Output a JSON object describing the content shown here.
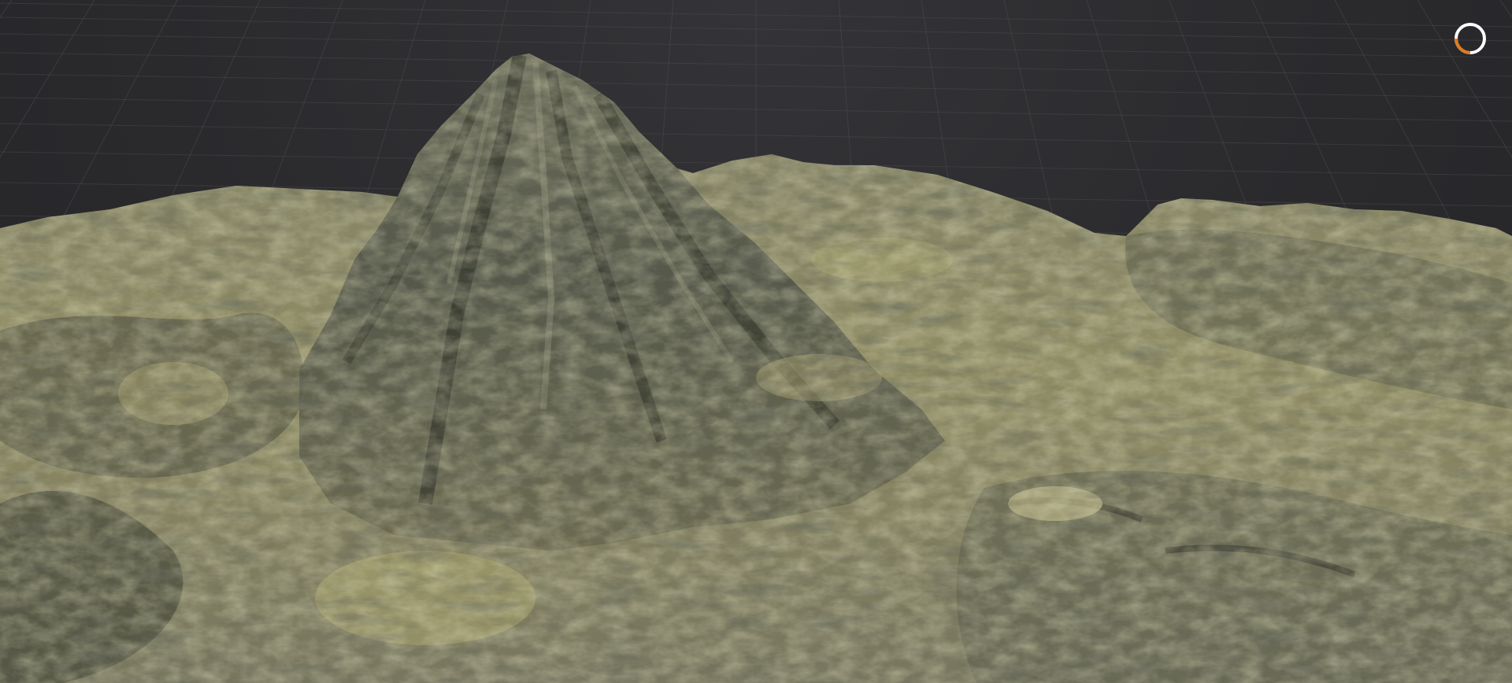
{
  "viewport": {
    "background_color": "#2a2a2d",
    "grid_line_color": "#4a4a50",
    "terrain_colors": {
      "rock_dark": "#3a3d33",
      "rock_mid": "#5f6252",
      "rock_light": "#7c7d69",
      "grass_yellow": "#a7a36d",
      "grass_pale": "#b9b58a",
      "shadow": "#24261f"
    }
  },
  "progress_indicator": {
    "icon": "loading-ring-icon",
    "progress": 0.25,
    "track_color": "#ffffff",
    "progress_color": "#e07a1f"
  }
}
